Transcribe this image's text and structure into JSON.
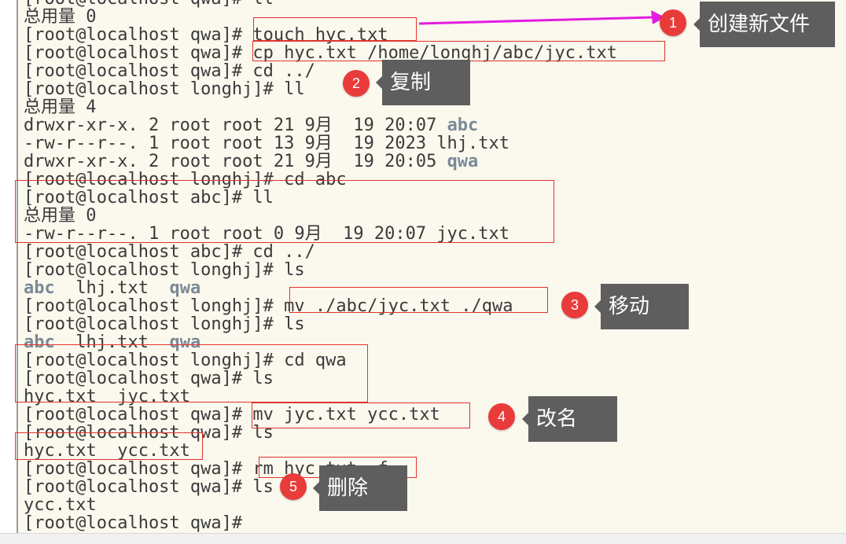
{
  "terminal": {
    "lines": [
      {
        "text": "[root@localhost qwa]# ll"
      },
      {
        "text": "总用量 0"
      },
      {
        "text": "[root@localhost qwa]# touch hyc.txt"
      },
      {
        "text": "[root@localhost qwa]# cp hyc.txt /home/longhj/abc/jyc.txt"
      },
      {
        "text": "[root@localhost qwa]# cd ../"
      },
      {
        "text": "[root@localhost longhj]# ll"
      },
      {
        "text": "总用量 4"
      },
      {
        "plain": "drwxr-xr-x. 2 root root 21 9月  19 20:07 ",
        "bold": "abc"
      },
      {
        "text": "-rw-r--r--. 1 root root 13 9月  19 2023 lhj.txt"
      },
      {
        "plain": "drwxr-xr-x. 2 root root 21 9月  19 20:05 ",
        "bold": "qwa"
      },
      {
        "text": "[root@localhost longhj]# cd abc"
      },
      {
        "text": "[root@localhost abc]# ll"
      },
      {
        "text": "总用量 0"
      },
      {
        "text": "-rw-r--r--. 1 root root 0 9月  19 20:07 jyc.txt"
      },
      {
        "text": "[root@localhost abc]# cd ../"
      },
      {
        "text": "[root@localhost longhj]# ls"
      },
      {
        "parts": [
          {
            "bold": "abc"
          },
          {
            "plain": "  lhj.txt  "
          },
          {
            "bold": "qwa"
          }
        ]
      },
      {
        "text": "[root@localhost longhj]# mv ./abc/jyc.txt ./qwa"
      },
      {
        "text": "[root@localhost longhj]# ls"
      },
      {
        "parts": [
          {
            "bold": "abc"
          },
          {
            "plain": "  lhj.txt  "
          },
          {
            "bold": "qwa"
          }
        ]
      },
      {
        "text": "[root@localhost longhj]# cd qwa"
      },
      {
        "text": "[root@localhost qwa]# ls"
      },
      {
        "text": "hyc.txt  jyc.txt"
      },
      {
        "text": "[root@localhost qwa]# mv jyc.txt ycc.txt"
      },
      {
        "text": "[root@localhost qwa]# ls"
      },
      {
        "text": "hyc.txt  ycc.txt"
      },
      {
        "text": "[root@localhost qwa]# rm hyc.txt -f"
      },
      {
        "text": "[root@localhost qwa]# ls"
      },
      {
        "text": "ycc.txt"
      },
      {
        "text": "[root@localhost qwa]#"
      }
    ]
  },
  "annotations": [
    {
      "number": "1",
      "label": "创建新文件"
    },
    {
      "number": "2",
      "label": "复制"
    },
    {
      "number": "3",
      "label": "移动"
    },
    {
      "number": "4",
      "label": "改名"
    },
    {
      "number": "5",
      "label": "删除"
    }
  ],
  "colors": {
    "terminal_background": "#fbf8ee",
    "terminal_text": "#3b3b3b",
    "directory_text": "#7a8a96",
    "highlight_box": "#e0342c",
    "badge": "#ea3b3b",
    "callout": "#5e5e5e",
    "arrow": "#e21ce0"
  }
}
